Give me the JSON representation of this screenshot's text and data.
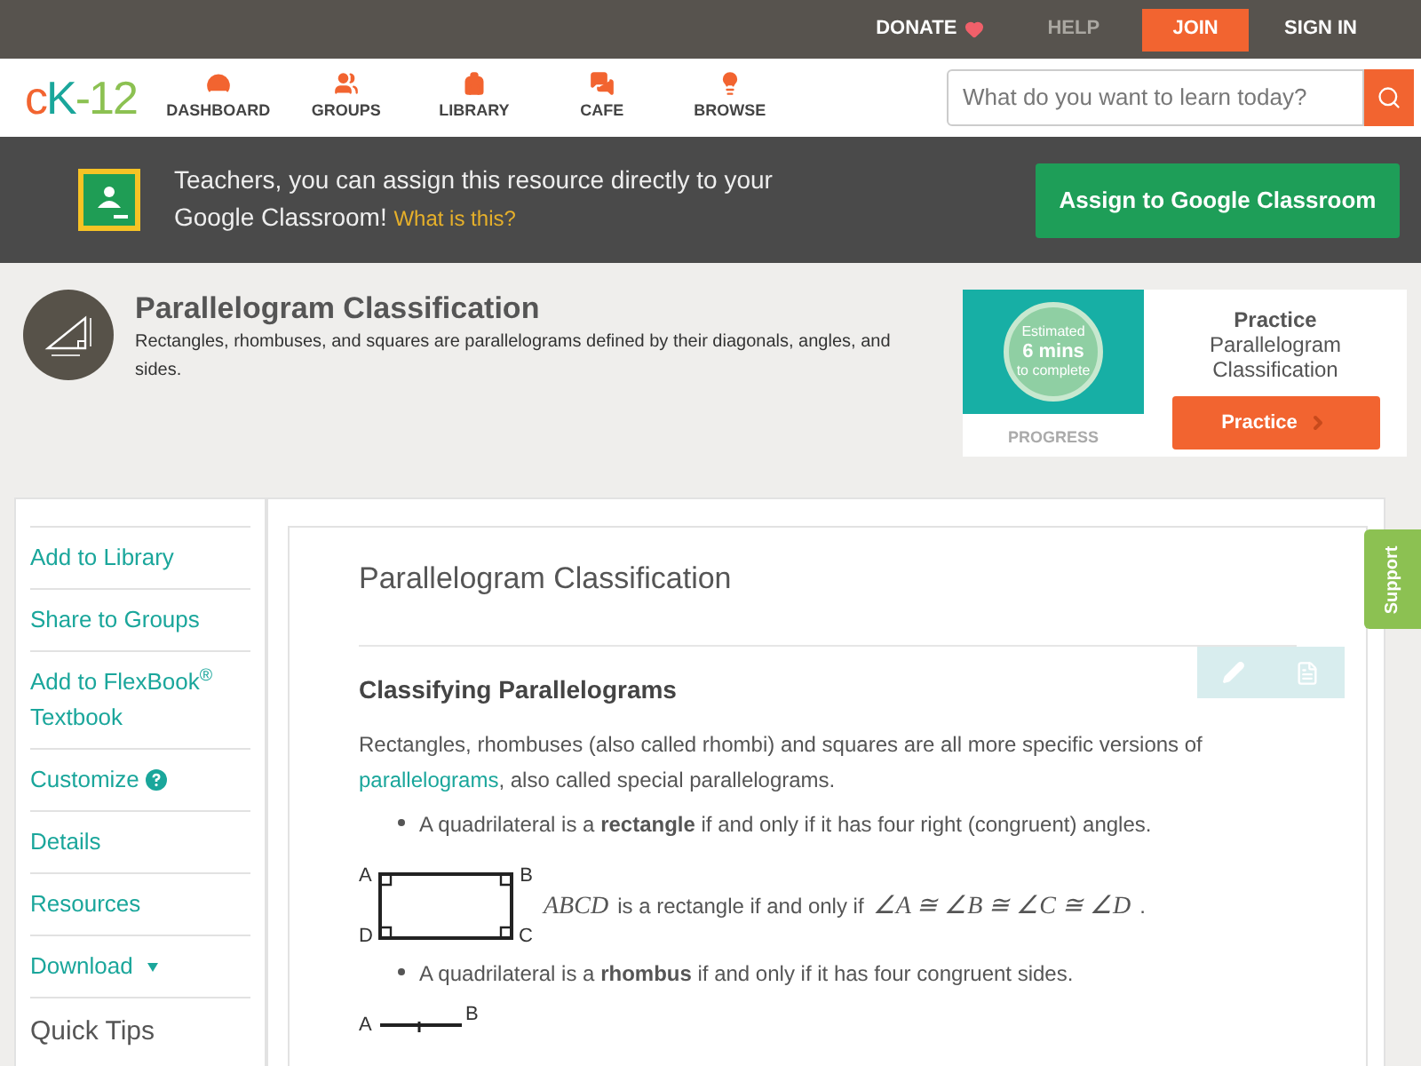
{
  "top_bar": [
    {
      "kind": "donate",
      "label": "DONATE"
    },
    {
      "kind": "muted",
      "label": "HELP"
    },
    {
      "kind": "button",
      "label": "JOIN"
    },
    {
      "kind": "link",
      "label": "SIGN IN"
    }
  ],
  "logo": {
    "first": "c",
    "second": "K",
    "third": "-12"
  },
  "nav": [
    {
      "label": "DASHBOARD"
    },
    {
      "label": "GROUPS"
    },
    {
      "label": "LIBRARY"
    },
    {
      "label": "CAFE"
    },
    {
      "label": "BROWSE"
    }
  ],
  "search": {
    "placeholder": "What do you want to learn today?"
  },
  "banner": {
    "text": "Teachers, you can assign this resource directly to your Google Classroom!",
    "link": "What is this?",
    "button": "Assign to Google Classroom"
  },
  "header": {
    "title": "Parallelogram Classification",
    "description": "Rectangles, rhombuses, and squares are parallelograms defined by their diagonals, angles, and sides."
  },
  "practice": {
    "estimate_top": "Estimated",
    "estimate_mid": "6 mins",
    "estimate_bottom": "to complete",
    "progress": "PROGRESS",
    "title": "**Practice** Parallelogram Classification",
    "button": "Practice"
  },
  "sidebar": [
    {
      "kind": "link",
      "label": "Add to Library"
    },
    {
      "kind": "link",
      "label": "Share to Groups"
    },
    {
      "kind": "link",
      "label": "Add to FlexBook$^{®}$ Textbook"
    },
    {
      "kind": "help",
      "label": "Customize"
    },
    {
      "kind": "link",
      "label": "Details"
    },
    {
      "kind": "link",
      "label": "Resources"
    },
    {
      "kind": "menu",
      "label": "Download"
    },
    {
      "kind": "heading",
      "label": "Quick Tips"
    }
  ],
  "support": "Support",
  "content": {
    "title": "Parallelogram Classification",
    "section": "Classifying Parallelograms",
    "intro_before": "Rectangles, rhombuses (also called rhombi) and squares are all more specific versions of",
    "intro_link": "parallelograms",
    "intro_after": ", also called special parallelograms.",
    "bullet_1": "A quadrilateral is a **rectangle** if and only if it has four right (congruent) angles.",
    "rect_labels": [
      "A",
      "B",
      "D",
      "C"
    ],
    "math_name": "ABCD",
    "math_text": "is a rectangle if and only if",
    "math_formula": "∠A ≅ ∠B ≅ ∠C ≅ ∠D",
    "math_end": ".",
    "bullet_2": "A quadrilateral is a **rhombus** if and only if it has four congruent sides.",
    "rhombus_labels": [
      "A",
      "B"
    ]
  }
}
